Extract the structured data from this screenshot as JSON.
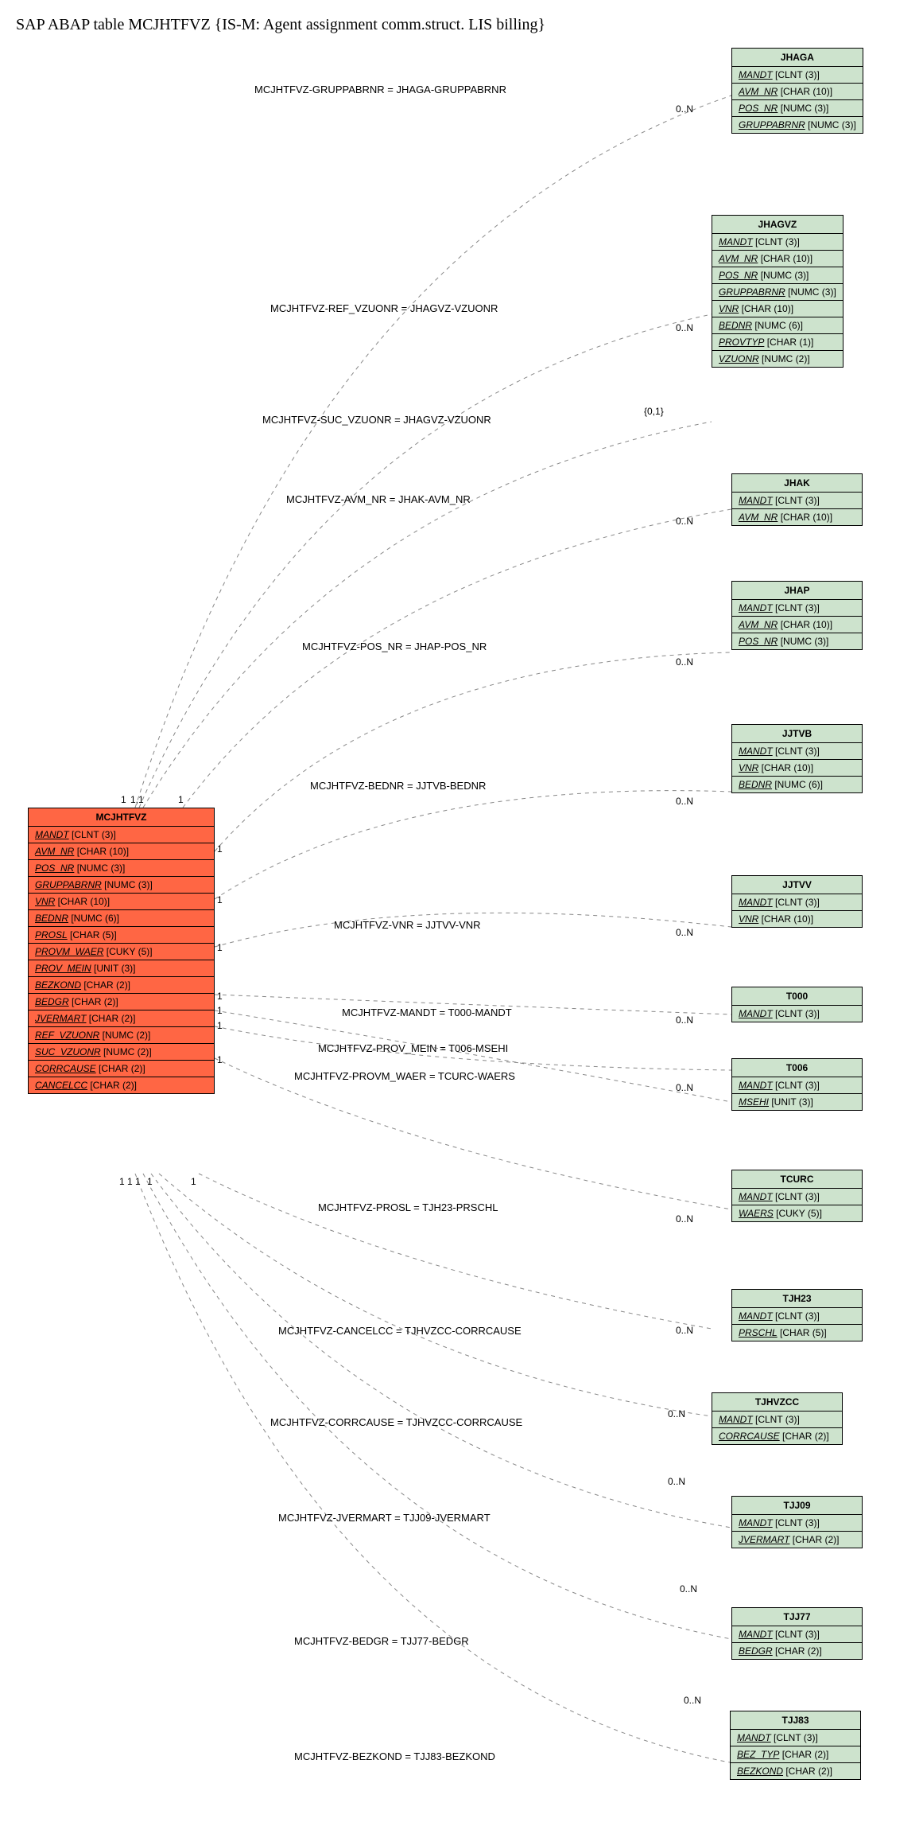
{
  "title": "SAP ABAP table MCJHTFVZ {IS-M: Agent assignment comm.struct. LIS billing}",
  "mainEntity": {
    "name": "MCJHTFVZ",
    "fields": [
      {
        "n": "MANDT",
        "t": "[CLNT (3)]"
      },
      {
        "n": "AVM_NR",
        "t": "[CHAR (10)]"
      },
      {
        "n": "POS_NR",
        "t": "[NUMC (3)]"
      },
      {
        "n": "GRUPPABRNR",
        "t": "[NUMC (3)]"
      },
      {
        "n": "VNR",
        "t": "[CHAR (10)]"
      },
      {
        "n": "BEDNR",
        "t": "[NUMC (6)]"
      },
      {
        "n": "PROSL",
        "t": "[CHAR (5)]"
      },
      {
        "n": "PROVM_WAER",
        "t": "[CUKY (5)]"
      },
      {
        "n": "PROV_MEIN",
        "t": "[UNIT (3)]"
      },
      {
        "n": "BEZKOND",
        "t": "[CHAR (2)]"
      },
      {
        "n": "BEDGR",
        "t": "[CHAR (2)]"
      },
      {
        "n": "JVERMART",
        "t": "[CHAR (2)]"
      },
      {
        "n": "REF_VZUONR",
        "t": "[NUMC (2)]"
      },
      {
        "n": "SUC_VZUONR",
        "t": "[NUMC (2)]"
      },
      {
        "n": "CORRCAUSE",
        "t": "[CHAR (2)]"
      },
      {
        "n": "CANCELCC",
        "t": "[CHAR (2)]"
      }
    ]
  },
  "refs": [
    {
      "name": "JHAGA",
      "fields": [
        {
          "n": "MANDT",
          "t": "[CLNT (3)]"
        },
        {
          "n": "AVM_NR",
          "t": "[CHAR (10)]"
        },
        {
          "n": "POS_NR",
          "t": "[NUMC (3)]"
        },
        {
          "n": "GRUPPABRNR",
          "t": "[NUMC (3)]"
        }
      ]
    },
    {
      "name": "JHAGVZ",
      "fields": [
        {
          "n": "MANDT",
          "t": "[CLNT (3)]"
        },
        {
          "n": "AVM_NR",
          "t": "[CHAR (10)]"
        },
        {
          "n": "POS_NR",
          "t": "[NUMC (3)]"
        },
        {
          "n": "GRUPPABRNR",
          "t": "[NUMC (3)]"
        },
        {
          "n": "VNR",
          "t": "[CHAR (10)]"
        },
        {
          "n": "BEDNR",
          "t": "[NUMC (6)]"
        },
        {
          "n": "PROVTYP",
          "t": "[CHAR (1)]"
        },
        {
          "n": "VZUONR",
          "t": "[NUMC (2)]"
        }
      ]
    },
    {
      "name": "JHAK",
      "fields": [
        {
          "n": "MANDT",
          "t": "[CLNT (3)]"
        },
        {
          "n": "AVM_NR",
          "t": "[CHAR (10)]"
        }
      ]
    },
    {
      "name": "JHAP",
      "fields": [
        {
          "n": "MANDT",
          "t": "[CLNT (3)]"
        },
        {
          "n": "AVM_NR",
          "t": "[CHAR (10)]"
        },
        {
          "n": "POS_NR",
          "t": "[NUMC (3)]"
        }
      ]
    },
    {
      "name": "JJTVB",
      "fields": [
        {
          "n": "MANDT",
          "t": "[CLNT (3)]"
        },
        {
          "n": "VNR",
          "t": "[CHAR (10)]"
        },
        {
          "n": "BEDNR",
          "t": "[NUMC (6)]"
        }
      ]
    },
    {
      "name": "JJTVV",
      "fields": [
        {
          "n": "MANDT",
          "t": "[CLNT (3)]"
        },
        {
          "n": "VNR",
          "t": "[CHAR (10)]"
        }
      ]
    },
    {
      "name": "T000",
      "fields": [
        {
          "n": "MANDT",
          "t": "[CLNT (3)]"
        }
      ]
    },
    {
      "name": "T006",
      "fields": [
        {
          "n": "MANDT",
          "t": "[CLNT (3)]"
        },
        {
          "n": "MSEHI",
          "t": "[UNIT (3)]"
        }
      ]
    },
    {
      "name": "TCURC",
      "fields": [
        {
          "n": "MANDT",
          "t": "[CLNT (3)]"
        },
        {
          "n": "WAERS",
          "t": "[CUKY (5)]"
        }
      ]
    },
    {
      "name": "TJH23",
      "fields": [
        {
          "n": "MANDT",
          "t": "[CLNT (3)]"
        },
        {
          "n": "PRSCHL",
          "t": "[CHAR (5)]"
        }
      ]
    },
    {
      "name": "TJHVZCC",
      "fields": [
        {
          "n": "MANDT",
          "t": "[CLNT (3)]"
        },
        {
          "n": "CORRCAUSE",
          "t": "[CHAR (2)]"
        }
      ]
    },
    {
      "name": "TJJ09",
      "fields": [
        {
          "n": "MANDT",
          "t": "[CLNT (3)]"
        },
        {
          "n": "JVERMART",
          "t": "[CHAR (2)]"
        }
      ]
    },
    {
      "name": "TJJ77",
      "fields": [
        {
          "n": "MANDT",
          "t": "[CLNT (3)]"
        },
        {
          "n": "BEDGR",
          "t": "[CHAR (2)]"
        }
      ]
    },
    {
      "name": "TJJ83",
      "fields": [
        {
          "n": "MANDT",
          "t": "[CLNT (3)]"
        },
        {
          "n": "BEZ_TYP",
          "t": "[CHAR (2)]"
        },
        {
          "n": "BEZKOND",
          "t": "[CHAR (2)]"
        }
      ]
    }
  ],
  "edges": [
    {
      "label": "MCJHTFVZ-GRUPPABRNR = JHAGA-GRUPPABRNR",
      "rcard": "0..N"
    },
    {
      "label": "MCJHTFVZ-REF_VZUONR = JHAGVZ-VZUONR",
      "rcard": "0..N"
    },
    {
      "label": "MCJHTFVZ-SUC_VZUONR = JHAGVZ-VZUONR",
      "rcard": "{0,1}"
    },
    {
      "label": "MCJHTFVZ-AVM_NR = JHAK-AVM_NR",
      "rcard": "0..N"
    },
    {
      "label": "MCJHTFVZ-POS_NR = JHAP-POS_NR",
      "rcard": "0..N"
    },
    {
      "label": "MCJHTFVZ-BEDNR = JJTVB-BEDNR",
      "rcard": "0..N"
    },
    {
      "label": "MCJHTFVZ-VNR = JJTVV-VNR",
      "rcard": "0..N"
    },
    {
      "label": "MCJHTFVZ-MANDT = T000-MANDT",
      "rcard": "0..N"
    },
    {
      "label": "MCJHTFVZ-PROV_MEIN = T006-MSEHI",
      "rcard": ""
    },
    {
      "label": "MCJHTFVZ-PROVM_WAER = TCURC-WAERS",
      "rcard": "0..N"
    },
    {
      "label": "MCJHTFVZ-PROSL = TJH23-PRSCHL",
      "rcard": "0..N"
    },
    {
      "label": "MCJHTFVZ-CANCELCC = TJHVZCC-CORRCAUSE",
      "rcard": "0..N"
    },
    {
      "label": "MCJHTFVZ-CORRCAUSE = TJHVZCC-CORRCAUSE",
      "rcard": "0..N"
    },
    {
      "label": "MCJHTFVZ-JVERMART = TJJ09-JVERMART",
      "rcard": "0..N"
    },
    {
      "label": "MCJHTFVZ-BEDGR = TJJ77-BEDGR",
      "rcard": "0..N"
    },
    {
      "label": "MCJHTFVZ-BEZKOND = TJJ83-BEZKOND",
      "rcard": "0..N"
    }
  ],
  "leftCards": [
    "1",
    "1,1",
    "1",
    "1",
    "1",
    "1",
    "1",
    "1",
    "1",
    "1",
    "1",
    "1",
    "1",
    "1",
    "1",
    "1"
  ]
}
